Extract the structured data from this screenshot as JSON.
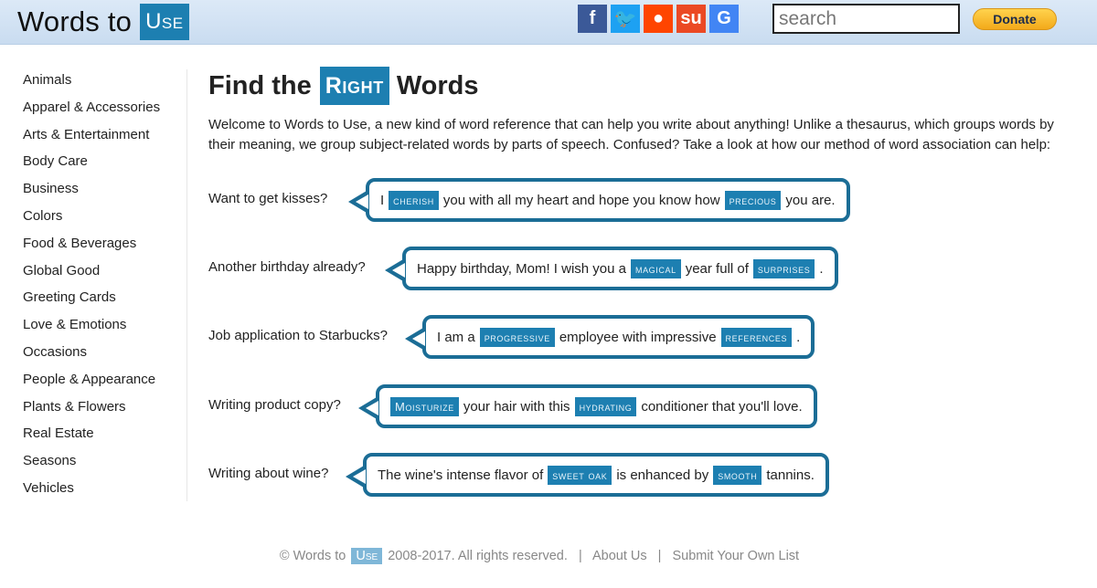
{
  "header": {
    "logo_text": "Words to",
    "logo_badge": "Use",
    "social": [
      {
        "name": "facebook-icon",
        "glyph": "f",
        "color": "#3b5998"
      },
      {
        "name": "twitter-icon",
        "glyph": "🐦",
        "color": "#1da1f2"
      },
      {
        "name": "reddit-icon",
        "glyph": "●",
        "color": "#ff4500"
      },
      {
        "name": "stumbleupon-icon",
        "glyph": "su",
        "color": "#eb4924"
      },
      {
        "name": "google-icon",
        "glyph": "G",
        "color": "#4285f4"
      }
    ],
    "search_placeholder": "search",
    "donate_label": "Donate"
  },
  "sidebar": {
    "items": [
      {
        "label": "Animals"
      },
      {
        "label": "Apparel & Accessories"
      },
      {
        "label": "Arts & Entertainment"
      },
      {
        "label": "Body Care"
      },
      {
        "label": "Business"
      },
      {
        "label": "Colors"
      },
      {
        "label": "Food & Beverages"
      },
      {
        "label": "Global Good"
      },
      {
        "label": "Greeting Cards"
      },
      {
        "label": "Love & Emotions"
      },
      {
        "label": "Occasions"
      },
      {
        "label": "People & Appearance"
      },
      {
        "label": "Plants & Flowers"
      },
      {
        "label": "Real Estate"
      },
      {
        "label": "Seasons"
      },
      {
        "label": "Vehicles"
      }
    ]
  },
  "main": {
    "title_pre": "Find the",
    "title_badge": "Right",
    "title_post": "Words",
    "intro": "Welcome to Words to Use, a new kind of word reference that can help you write about anything! Unlike a thesaurus, which groups words by their meaning, we group subject-related words by parts of speech. Confused? Take a look at how our method of word association can help:",
    "examples": [
      {
        "question": "Want to get kisses?",
        "parts": [
          "I",
          "cherish",
          "you with all my heart and hope you know how",
          "precious",
          "you are."
        ]
      },
      {
        "question": "Another birthday already?",
        "parts": [
          "Happy birthday, Mom! I wish you a",
          "magical",
          "year full of",
          "surprises",
          "."
        ]
      },
      {
        "question": "Job application to Starbucks?",
        "parts": [
          "I am a",
          "progressive",
          "employee with impressive",
          "references",
          "."
        ]
      },
      {
        "question": "Writing product copy?",
        "parts": [
          "",
          "Moisturize",
          "your hair with this",
          "hydrating",
          "conditioner that you'll love."
        ]
      },
      {
        "question": "Writing about wine?",
        "parts": [
          "The wine's intense flavor of",
          "sweet oak",
          "is enhanced by",
          "smooth",
          "tannins."
        ]
      }
    ]
  },
  "footer": {
    "copyright_pre": "© Words to",
    "copyright_badge": "Use",
    "copyright_post": "2008-2017. All rights reserved.",
    "separator": "|",
    "about_label": "About Us",
    "submit_label": "Submit Your Own List"
  }
}
